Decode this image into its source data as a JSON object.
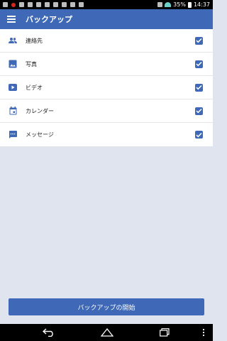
{
  "status_bar": {
    "battery": "35%",
    "time": "14:37",
    "icons": [
      "record-icon",
      "notification-icon",
      "notification-icon",
      "notification-icon",
      "notification-icon",
      "notification-icon",
      "notification-icon",
      "notification-icon",
      "notification-icon",
      "notification-icon"
    ]
  },
  "app_bar": {
    "title": "バックアップ",
    "menu_icon": "hamburger-menu-icon"
  },
  "items": [
    {
      "label": "連絡先",
      "icon": "contacts-icon",
      "checked": true
    },
    {
      "label": "写真",
      "icon": "photo-icon",
      "checked": true
    },
    {
      "label": "ビデオ",
      "icon": "video-icon",
      "checked": true
    },
    {
      "label": "カレンダー",
      "icon": "calendar-icon",
      "checked": true
    },
    {
      "label": "メッセージ",
      "icon": "message-icon",
      "checked": true
    }
  ],
  "start_button": {
    "label": "バックアップの開始"
  },
  "nav": [
    "back-icon",
    "home-icon",
    "recent-apps-icon",
    "overflow-icon"
  ],
  "colors": {
    "primary": "#3f69b6",
    "background": "#dfe4ee"
  }
}
